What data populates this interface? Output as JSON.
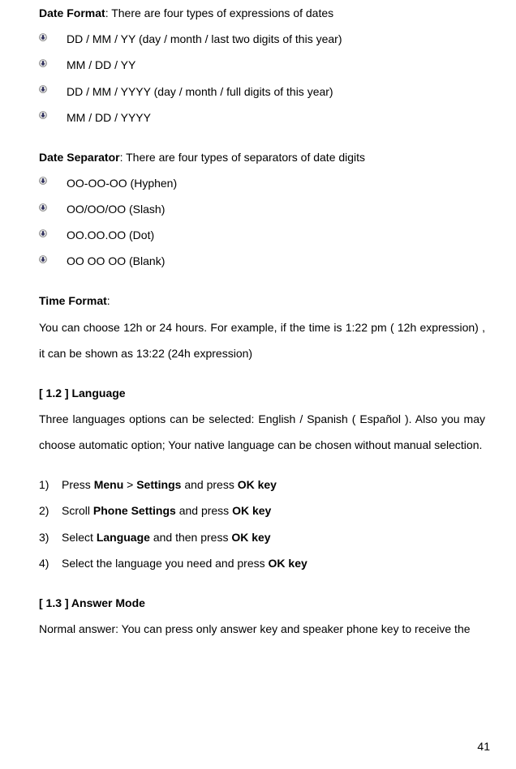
{
  "dateFormat": {
    "title": "Date Format",
    "desc": ": There are four types of expressions of dates",
    "items": [
      "DD / MM / YY (day / month / last two digits of this year)",
      "MM / DD / YY",
      "DD / MM / YYYY (day / month / full digits of this year)",
      "MM / DD / YYYY"
    ]
  },
  "dateSeparator": {
    "title": "Date Separator",
    "desc": ": There are four types of separators of date digits",
    "items": [
      "OO-OO-OO (Hyphen)",
      "OO/OO/OO (Slash)",
      "OO.OO.OO (Dot)",
      "OO OO OO (Blank)"
    ]
  },
  "timeFormat": {
    "title": "Time Format",
    "colon": ":",
    "body": "You can choose 12h or 24 hours. For example, if the time is 1:22 pm ( 12h expression) , it can be shown as 13:22 (24h expression)"
  },
  "language": {
    "heading": "[ 1.2 ]   Language",
    "body": "Three languages options can be selected: English / Spanish ( Español ). Also you may choose automatic option; Your native language can be chosen without manual selection.",
    "steps": [
      {
        "num": "1)",
        "pre": "Press ",
        "b1": "Menu",
        "mid": " > ",
        "b2": "Settings",
        "post": " and press ",
        "b3": "OK key"
      },
      {
        "num": "2)",
        "pre": "Scroll ",
        "b1": "Phone Settings",
        "mid": " and press ",
        "b2": "OK key",
        "post": "",
        "b3": ""
      },
      {
        "num": "3)",
        "pre": "Select ",
        "b1": "Language",
        "mid": " and then press ",
        "b2": "OK key",
        "post": "",
        "b3": ""
      },
      {
        "num": "4)",
        "pre": "Select the language you need and press ",
        "b1": "OK key",
        "mid": "",
        "b2": "",
        "post": "",
        "b3": ""
      }
    ]
  },
  "answerMode": {
    "heading": "[ 1.3 ]   Answer Mode",
    "body": "Normal answer: You can press only answer key and speaker phone key to receive the"
  },
  "pageNumber": "41"
}
